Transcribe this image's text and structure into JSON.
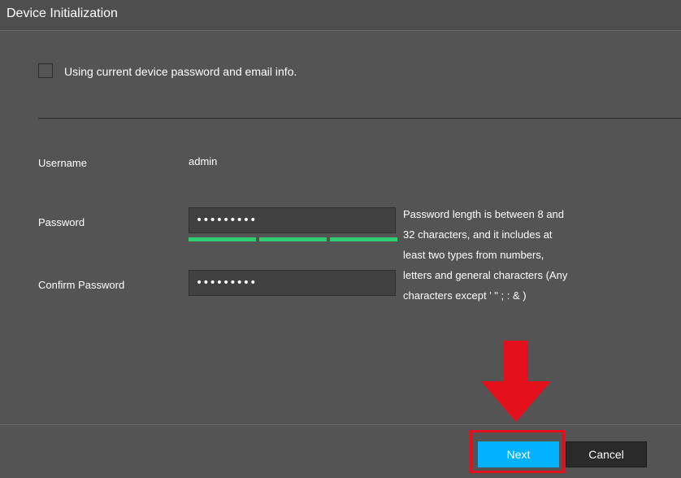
{
  "window": {
    "title": "Device Initialization"
  },
  "option": {
    "use_current_label": "Using current device password and email info.",
    "checked": false
  },
  "form": {
    "username_label": "Username",
    "username_value": "admin",
    "password_label": "Password",
    "password_value": "•••••••••",
    "confirm_label": "Confirm Password",
    "confirm_value": "•••••••••",
    "strength_segments_filled": 3,
    "hint": "Password length is between 8 and 32 characters, and it includes at least two types from numbers, letters and general characters (Any characters except   ' \" ; : & )"
  },
  "footer": {
    "next_label": "Next",
    "cancel_label": "Cancel"
  },
  "colors": {
    "background": "#545454",
    "strength": "#2ecc71",
    "primary_button": "#00b2ff",
    "annotation": "#e4101c"
  },
  "annotation": {
    "arrow_icon": "down-arrow-icon"
  }
}
